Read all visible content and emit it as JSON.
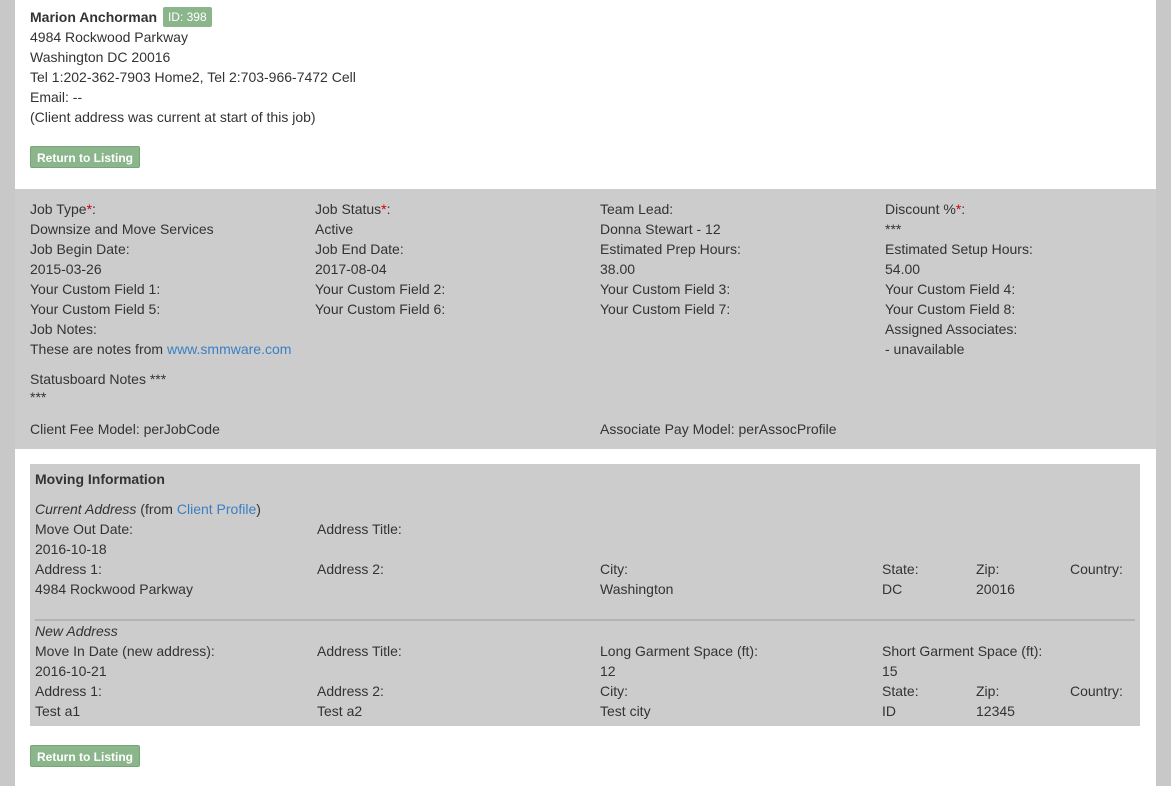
{
  "client": {
    "name": "Marion Anchorman",
    "id_badge": "ID: 398",
    "address_line1": "4984 Rockwood Parkway",
    "address_line2": "Washington DC 20016",
    "phones": "Tel 1:202-362-7903 Home2, Tel 2:703-966-7472 Cell",
    "email": "Email: --",
    "address_note": "(Client address was current at start of this job)"
  },
  "buttons": {
    "return_label": "Return to Listing"
  },
  "job": {
    "job_type_label": "Job Type",
    "job_type_value": "Downsize and Move Services",
    "job_status_label": "Job Status",
    "job_status_value": "Active",
    "team_lead_label": "Team Lead:",
    "team_lead_value": "Donna Stewart - 12",
    "discount_label": "Discount %",
    "discount_value": "***",
    "begin_date_label": "Job Begin Date:",
    "begin_date_value": "2015-03-26",
    "end_date_label": "Job End Date:",
    "end_date_value": "2017-08-04",
    "prep_hours_label": "Estimated Prep Hours:",
    "prep_hours_value": "38.00",
    "setup_hours_label": "Estimated Setup Hours:",
    "setup_hours_value": "54.00",
    "custom1": "Your Custom Field 1:",
    "custom2": "Your Custom Field 2:",
    "custom3": "Your Custom Field 3:",
    "custom4": "Your Custom Field 4:",
    "custom5": "Your Custom Field 5:",
    "custom6": "Your Custom Field 6:",
    "custom7": "Your Custom Field 7:",
    "custom8": "Your Custom Field 8:",
    "notes_label": "Job Notes:",
    "notes_prefix": "These are notes from ",
    "notes_link": "www.smmware.com",
    "assoc_label": "Assigned Associates:",
    "assoc_value": "- unavailable",
    "statusboard_label": "Statusboard Notes ***",
    "statusboard_value": "***",
    "client_fee_model": "Client Fee Model: perJobCode",
    "assoc_pay_model": "Associate Pay Model: perAssocProfile"
  },
  "moving": {
    "title": "Moving Information",
    "current_heading": "Current Address",
    "current_from_open": " (from ",
    "client_profile_link": "Client Profile",
    "current_from_close": ")",
    "move_out_label": "Move Out Date:",
    "move_out_value": "2016-10-18",
    "address_title_label": "Address Title:",
    "address1_label": "Address 1:",
    "address2_label": "Address 2:",
    "city_label": "City:",
    "state_label": "State:",
    "zip_label": "Zip:",
    "country_label": "Country:",
    "current_address1": "4984 Rockwood Parkway",
    "current_city": "Washington",
    "current_state": "DC",
    "current_zip": "20016",
    "new_heading": "New Address",
    "move_in_label": "Move In Date (new address):",
    "move_in_value": "2016-10-21",
    "long_garment_label": "Long Garment Space (ft):",
    "long_garment_value": "12",
    "short_garment_label": "Short Garment Space (ft):",
    "short_garment_value": "15",
    "new_address1": "Test a1",
    "new_address2": "Test a2",
    "new_city": "Test city",
    "new_state": "ID",
    "new_zip": "12345"
  },
  "colors": {
    "badge_green": "#8bb68b",
    "panel_gray": "#cccccc",
    "link_blue": "#3a7fc4",
    "required_red": "#d00000"
  }
}
